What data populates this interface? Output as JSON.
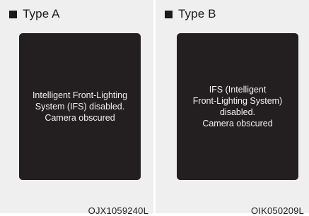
{
  "panels": [
    {
      "header": "Type A",
      "message": "Intelligent Front-Lighting\nSystem (IFS) disabled.\nCamera obscured",
      "code": "OJX1059240L"
    },
    {
      "header": "Type B",
      "message": "IFS (Intelligent\nFront-Lighting System)\ndisabled.\nCamera obscured",
      "code": "OIK050209L"
    }
  ],
  "colors": {
    "panel_background": "#efefef",
    "screen_background": "#231f20",
    "screen_text": "#f2f2f2"
  },
  "icons": {
    "header_marker": "filled-square-icon"
  }
}
